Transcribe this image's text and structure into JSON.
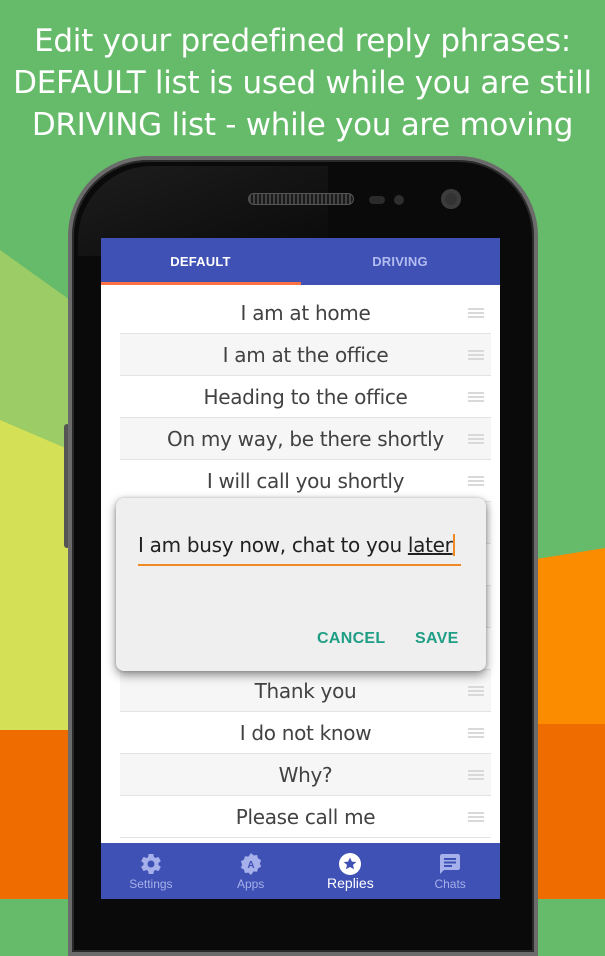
{
  "caption": {
    "lines": [
      "Edit your predefined reply phrases:",
      "DEFAULT list is used while you are still",
      "DRIVING list - while you are moving"
    ]
  },
  "colors": {
    "primary": "#3f51b5",
    "tab_indicator": "#ff7043",
    "dialog_accent": "#1e9e85",
    "input_underline": "#f08a24",
    "bg_green": "#66bb6a",
    "bg_light_green": "#9ccc65",
    "bg_yellow": "#d4e157",
    "bg_orange": "#fb8c00",
    "bg_dark_orange": "#ef6c00"
  },
  "tabs": [
    {
      "label": "DEFAULT",
      "active": true
    },
    {
      "label": "DRIVING",
      "active": false
    }
  ],
  "replies_top": [
    "I am at home",
    "I am at the office",
    "Heading to the office",
    "On my way, be there shortly",
    "I will call you shortly"
  ],
  "replies_bottom": [
    "Thank you",
    "I do not know",
    "Why?",
    "Please call me"
  ],
  "dialog": {
    "input_text": "I am busy now, chat to you ",
    "input_suggestion": "later",
    "cancel_label": "CANCEL",
    "save_label": "SAVE"
  },
  "bottom_nav": [
    {
      "label": "Settings",
      "icon": "gear-icon",
      "active": false
    },
    {
      "label": "Apps",
      "icon": "apps-badge-icon",
      "active": false
    },
    {
      "label": "Replies",
      "icon": "star-circle-icon",
      "active": true
    },
    {
      "label": "Chats",
      "icon": "chat-icon",
      "active": false
    }
  ]
}
